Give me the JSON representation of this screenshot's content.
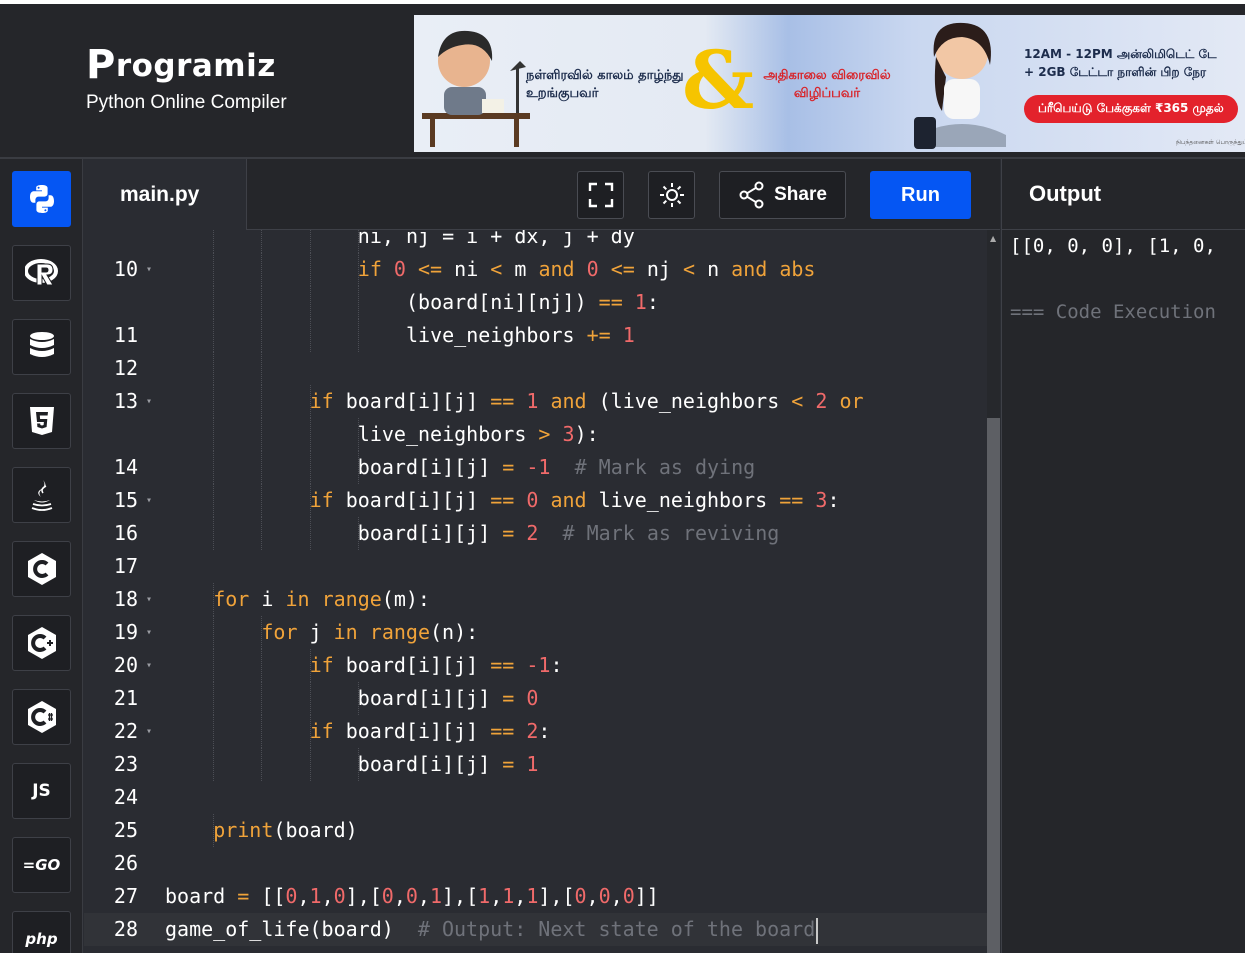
{
  "brand": {
    "logo_initial": "P",
    "logo_rest": "rogramiz",
    "subtitle": "Python Online Compiler"
  },
  "ad": {
    "left_text": "நள்ளிரவில் காலம் தாழ்ந்து உறங்குபவர்",
    "amp": "&",
    "middle_text": "அதிகாலை விரைவில் விழிப்பவர்",
    "offer_line1": "12AM - 12PM அன்லிமிடெட் டே",
    "offer_line2": "+ 2GB டேட்டா நாளின் பிற நேர",
    "cta": "ப்ரீபெய்டு பேக்குகள் ₹365 முதல்",
    "fine_print": "நிபந்தனைகள் பொருந்தும்"
  },
  "sidebar": {
    "languages": [
      {
        "name": "python",
        "label": ""
      },
      {
        "name": "r",
        "label": "R"
      },
      {
        "name": "sql",
        "label": ""
      },
      {
        "name": "html",
        "label": "5"
      },
      {
        "name": "java",
        "label": ""
      },
      {
        "name": "c",
        "label": "C"
      },
      {
        "name": "cpp",
        "label": "C"
      },
      {
        "name": "csharp",
        "label": "C"
      },
      {
        "name": "js",
        "label": "JS"
      },
      {
        "name": "go",
        "label": "GO"
      },
      {
        "name": "php",
        "label": "php"
      }
    ]
  },
  "toolbar": {
    "file_name": "main.py",
    "share_label": "Share",
    "run_label": "Run"
  },
  "output": {
    "title": "Output",
    "line1": "[[0, 0, 0], [1, 0,",
    "line2": "=== Code Execution"
  },
  "editor": {
    "lines": [
      {
        "n": "",
        "fold": false,
        "indent": 4,
        "tokens": [
          [
            "t",
            "ni, nj = i + dx, j + dy"
          ]
        ],
        "partial": true
      },
      {
        "n": "10",
        "fold": true,
        "indent": 4,
        "tokens": [
          [
            "k",
            "if "
          ],
          [
            "n",
            "0"
          ],
          [
            "t",
            " "
          ],
          [
            "o",
            "<="
          ],
          [
            "t",
            " ni "
          ],
          [
            "o",
            "<"
          ],
          [
            "t",
            " m "
          ],
          [
            "k",
            "and "
          ],
          [
            "n",
            "0"
          ],
          [
            "t",
            " "
          ],
          [
            "o",
            "<="
          ],
          [
            "t",
            " nj "
          ],
          [
            "o",
            "<"
          ],
          [
            "t",
            " n "
          ],
          [
            "k",
            "and"
          ],
          [
            "t",
            " "
          ],
          [
            "k",
            "abs"
          ]
        ]
      },
      {
        "n": "",
        "fold": false,
        "indent": 5,
        "tokens": [
          [
            "t",
            "(board[ni][nj]) "
          ],
          [
            "o",
            "=="
          ],
          [
            "t",
            " "
          ],
          [
            "n",
            "1"
          ],
          [
            "t",
            ":"
          ]
        ]
      },
      {
        "n": "11",
        "fold": false,
        "indent": 5,
        "tokens": [
          [
            "t",
            "live_neighbors "
          ],
          [
            "o",
            "+="
          ],
          [
            "t",
            " "
          ],
          [
            "n",
            "1"
          ]
        ]
      },
      {
        "n": "12",
        "fold": false,
        "indent": 2,
        "tokens": []
      },
      {
        "n": "13",
        "fold": true,
        "indent": 3,
        "tokens": [
          [
            "k",
            "if"
          ],
          [
            "t",
            " board[i][j] "
          ],
          [
            "o",
            "=="
          ],
          [
            "t",
            " "
          ],
          [
            "n",
            "1"
          ],
          [
            "t",
            " "
          ],
          [
            "k",
            "and"
          ],
          [
            "t",
            " (live_neighbors "
          ],
          [
            "o",
            "<"
          ],
          [
            "t",
            " "
          ],
          [
            "n",
            "2"
          ],
          [
            "t",
            " "
          ],
          [
            "k",
            "or"
          ]
        ]
      },
      {
        "n": "",
        "fold": false,
        "indent": 4,
        "tokens": [
          [
            "t",
            "live_neighbors "
          ],
          [
            "o",
            ">"
          ],
          [
            "t",
            " "
          ],
          [
            "n",
            "3"
          ],
          [
            "t",
            "):"
          ]
        ]
      },
      {
        "n": "14",
        "fold": false,
        "indent": 4,
        "tokens": [
          [
            "t",
            "board[i][j] "
          ],
          [
            "o",
            "="
          ],
          [
            "t",
            " "
          ],
          [
            "n",
            "-1"
          ],
          [
            "t",
            "  "
          ],
          [
            "c",
            "# Mark as dying"
          ]
        ]
      },
      {
        "n": "15",
        "fold": true,
        "indent": 3,
        "tokens": [
          [
            "k",
            "if"
          ],
          [
            "t",
            " board[i][j] "
          ],
          [
            "o",
            "=="
          ],
          [
            "t",
            " "
          ],
          [
            "n",
            "0"
          ],
          [
            "t",
            " "
          ],
          [
            "k",
            "and"
          ],
          [
            "t",
            " live_neighbors "
          ],
          [
            "o",
            "=="
          ],
          [
            "t",
            " "
          ],
          [
            "n",
            "3"
          ],
          [
            "t",
            ":"
          ]
        ]
      },
      {
        "n": "16",
        "fold": false,
        "indent": 4,
        "tokens": [
          [
            "t",
            "board[i][j] "
          ],
          [
            "o",
            "="
          ],
          [
            "t",
            " "
          ],
          [
            "n",
            "2"
          ],
          [
            "t",
            "  "
          ],
          [
            "c",
            "# Mark as reviving"
          ]
        ]
      },
      {
        "n": "17",
        "fold": false,
        "indent": 0,
        "tokens": []
      },
      {
        "n": "18",
        "fold": true,
        "indent": 1,
        "tokens": [
          [
            "k",
            "for"
          ],
          [
            "t",
            " i "
          ],
          [
            "k",
            "in"
          ],
          [
            "t",
            " "
          ],
          [
            "k",
            "range"
          ],
          [
            "t",
            "(m):"
          ]
        ]
      },
      {
        "n": "19",
        "fold": true,
        "indent": 2,
        "tokens": [
          [
            "k",
            "for"
          ],
          [
            "t",
            " j "
          ],
          [
            "k",
            "in"
          ],
          [
            "t",
            " "
          ],
          [
            "k",
            "range"
          ],
          [
            "t",
            "(n):"
          ]
        ]
      },
      {
        "n": "20",
        "fold": true,
        "indent": 3,
        "tokens": [
          [
            "k",
            "if"
          ],
          [
            "t",
            " board[i][j] "
          ],
          [
            "o",
            "=="
          ],
          [
            "t",
            " "
          ],
          [
            "n",
            "-1"
          ],
          [
            "t",
            ":"
          ]
        ]
      },
      {
        "n": "21",
        "fold": false,
        "indent": 4,
        "tokens": [
          [
            "t",
            "board[i][j] "
          ],
          [
            "o",
            "="
          ],
          [
            "t",
            " "
          ],
          [
            "n",
            "0"
          ]
        ]
      },
      {
        "n": "22",
        "fold": true,
        "indent": 3,
        "tokens": [
          [
            "k",
            "if"
          ],
          [
            "t",
            " board[i][j] "
          ],
          [
            "o",
            "=="
          ],
          [
            "t",
            " "
          ],
          [
            "n",
            "2"
          ],
          [
            "t",
            ":"
          ]
        ]
      },
      {
        "n": "23",
        "fold": false,
        "indent": 4,
        "tokens": [
          [
            "t",
            "board[i][j] "
          ],
          [
            "o",
            "="
          ],
          [
            "t",
            " "
          ],
          [
            "n",
            "1"
          ]
        ]
      },
      {
        "n": "24",
        "fold": false,
        "indent": 0,
        "tokens": []
      },
      {
        "n": "25",
        "fold": false,
        "indent": 1,
        "tokens": [
          [
            "k",
            "print"
          ],
          [
            "t",
            "(board)"
          ]
        ]
      },
      {
        "n": "26",
        "fold": false,
        "indent": 0,
        "tokens": []
      },
      {
        "n": "27",
        "fold": false,
        "indent": 0,
        "tokens": [
          [
            "t",
            "board "
          ],
          [
            "o",
            "="
          ],
          [
            "t",
            " [["
          ],
          [
            "n",
            "0"
          ],
          [
            "t",
            ","
          ],
          [
            "n",
            "1"
          ],
          [
            "t",
            ","
          ],
          [
            "n",
            "0"
          ],
          [
            "t",
            "],["
          ],
          [
            "n",
            "0"
          ],
          [
            "t",
            ","
          ],
          [
            "n",
            "0"
          ],
          [
            "t",
            ","
          ],
          [
            "n",
            "1"
          ],
          [
            "t",
            "],["
          ],
          [
            "n",
            "1"
          ],
          [
            "t",
            ","
          ],
          [
            "n",
            "1"
          ],
          [
            "t",
            ","
          ],
          [
            "n",
            "1"
          ],
          [
            "t",
            "],["
          ],
          [
            "n",
            "0"
          ],
          [
            "t",
            ","
          ],
          [
            "n",
            "0"
          ],
          [
            "t",
            ","
          ],
          [
            "n",
            "0"
          ],
          [
            "t",
            "]]"
          ]
        ]
      },
      {
        "n": "28",
        "fold": false,
        "indent": 0,
        "tokens": [
          [
            "t",
            "game_of_life(board)  "
          ],
          [
            "c",
            "# Output: Next state of the board"
          ]
        ],
        "active": true
      }
    ]
  },
  "colors": {
    "accent": "#0556f3",
    "keyword": "#f0a33a",
    "number": "#f06a6a",
    "comment": "#6f727a",
    "background": "#2a2c32"
  }
}
